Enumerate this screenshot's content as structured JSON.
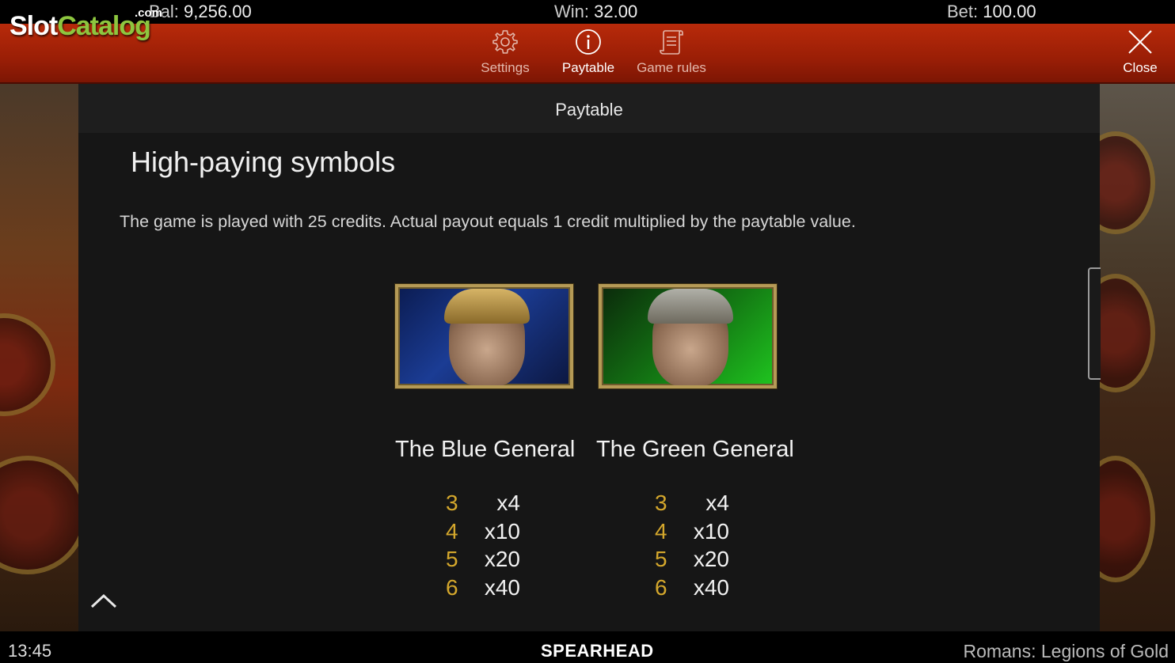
{
  "status": {
    "balance_label": "Bal:",
    "balance_value": "9,256.00",
    "win_label": "Win:",
    "win_value": "32.00",
    "bet_label": "Bet:",
    "bet_value": "100.00"
  },
  "watermark": {
    "slot": "Slot",
    "catalog": "Catalog",
    "dotcom": ".com"
  },
  "nav": {
    "settings": {
      "label": "Settings",
      "icon": "gear-icon"
    },
    "paytable": {
      "label": "Paytable",
      "icon": "info-icon"
    },
    "rules": {
      "label": "Game rules",
      "icon": "scroll-icon"
    },
    "close": {
      "label": "Close",
      "icon": "close-icon"
    }
  },
  "panel": {
    "title": "Paytable",
    "section_title": "High-paying symbols",
    "description": "The game is played with 25 credits. Actual payout equals 1 credit multiplied by the paytable value.",
    "symbols": [
      {
        "name": "The Blue General",
        "pays": [
          {
            "count": "3",
            "mult": "x4"
          },
          {
            "count": "4",
            "mult": "x10"
          },
          {
            "count": "5",
            "mult": "x20"
          },
          {
            "count": "6",
            "mult": "x40"
          }
        ]
      },
      {
        "name": "The Green General",
        "pays": [
          {
            "count": "3",
            "mult": "x4"
          },
          {
            "count": "4",
            "mult": "x10"
          },
          {
            "count": "5",
            "mult": "x20"
          },
          {
            "count": "6",
            "mult": "x40"
          }
        ]
      }
    ]
  },
  "footer": {
    "time": "13:45",
    "brand": "SPEARHEAD",
    "game_name": "Romans: Legions of Gold"
  },
  "colors": {
    "accent_gold": "#d4a72c",
    "nav_red": "#9a1e06",
    "panel_bg": "#161616"
  }
}
